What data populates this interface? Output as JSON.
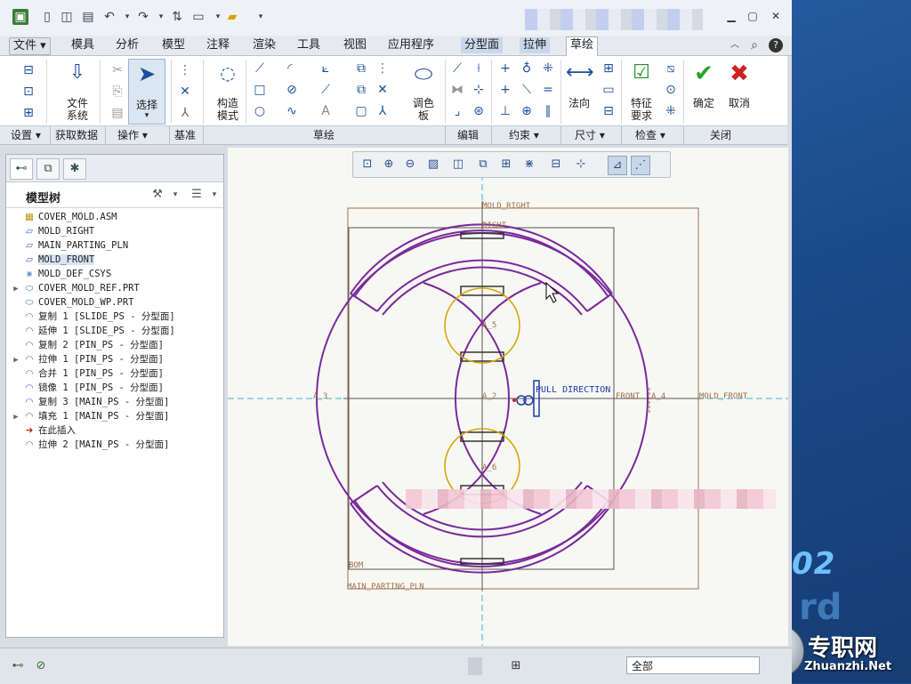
{
  "tabs": [
    "文件",
    "模具",
    "分析",
    "模型",
    "注释",
    "渲染",
    "工具",
    "视图",
    "应用程序",
    "分型面",
    "拉伸",
    "草绘"
  ],
  "ribbon": {
    "file_system": "文件\n系统",
    "select": "选择",
    "construct_mode": "构造\n模式",
    "palette": "调色\n板",
    "normal": "法向",
    "feature_req": "特征\n要求",
    "ok": "确定",
    "cancel": "取消",
    "groups": [
      "设置",
      "获取数据",
      "操作",
      "基准",
      "草绘",
      "编辑",
      "约束",
      "尺寸",
      "检查",
      "关闭"
    ]
  },
  "model_tree": {
    "title": "模型树",
    "items": [
      {
        "label": "COVER_MOLD.ASM",
        "icon": "assembly-icon",
        "expand": false
      },
      {
        "label": "MOLD_RIGHT",
        "icon": "datum-plane-icon",
        "expand": false
      },
      {
        "label": "MAIN_PARTING_PLN",
        "icon": "datum-plane-icon",
        "expand": false
      },
      {
        "label": "MOLD_FRONT",
        "icon": "datum-plane-icon",
        "expand": false
      },
      {
        "label": "MOLD_DEF_CSYS",
        "icon": "csys-icon",
        "expand": false
      },
      {
        "label": "COVER_MOLD_REF.PRT",
        "icon": "part-icon",
        "expand": true
      },
      {
        "label": "COVER_MOLD_WP.PRT",
        "icon": "part-icon",
        "expand": false
      },
      {
        "label": "复制 1 [SLIDE_PS - 分型面]",
        "icon": "surface-icon",
        "expand": false
      },
      {
        "label": "延伸 1 [SLIDE_PS - 分型面]",
        "icon": "surface-icon",
        "expand": false
      },
      {
        "label": "复制 2 [PIN_PS - 分型面]",
        "icon": "surface-icon",
        "expand": false
      },
      {
        "label": "拉伸 1 [PIN_PS - 分型面]",
        "icon": "surface-icon",
        "expand": true
      },
      {
        "label": "合并 1 [PIN_PS - 分型面]",
        "icon": "surface-icon",
        "expand": false
      },
      {
        "label": "镜像 1 [PIN_PS - 分型面]",
        "icon": "surface-icon",
        "expand": false
      },
      {
        "label": "复制 3 [MAIN_PS - 分型面]",
        "icon": "surface-icon",
        "expand": false
      },
      {
        "label": "填充 1 [MAIN_PS - 分型面]",
        "icon": "surface-icon",
        "expand": true
      },
      {
        "label": "在此插入",
        "icon": "insert-arrow-icon",
        "expand": false
      },
      {
        "label": "拉伸 2 [MAIN_PS - 分型面]",
        "icon": "extrude-surface-icon",
        "expand": false
      }
    ]
  },
  "sketch": {
    "labels": {
      "mold_right_top": "MOLD_RIGHT",
      "right": "RIGHT",
      "a5": "A_5",
      "a3": "A_3",
      "a2": "A_2",
      "pull_direction": "PULL DIRECTION",
      "front": "FRONT",
      "a4": "A_4",
      "mold_front": "MOLD_FRONT",
      "a6": "A_6",
      "bottom": "BOM",
      "main_parting_pln": "MAIN_PARTING_PLN"
    }
  },
  "status": {
    "filter": "全部"
  },
  "desktop": {
    "number": "02",
    "ghost": "rd"
  },
  "watermark": {
    "cn": "专职网",
    "en": "Zhuanzhi.Net"
  },
  "colors": {
    "sketch": "#7a2a9a",
    "circle": "#d4a400",
    "centerline": "#3fb6d0",
    "datum": "#a0704a",
    "pull": "#1e3fa8"
  }
}
